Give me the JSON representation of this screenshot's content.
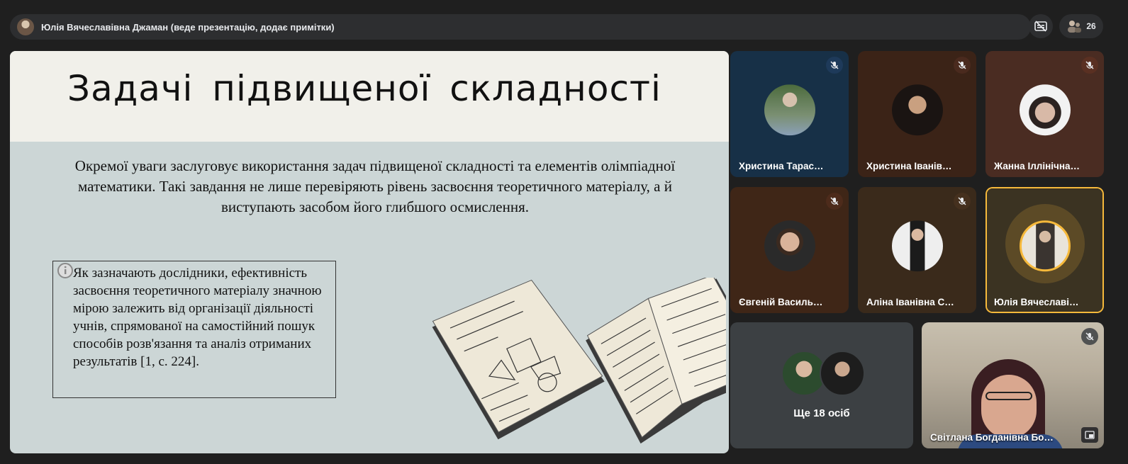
{
  "header": {
    "presenter": "Юлія Вячеславівна Джаман (веде презентацію, додає примітки)",
    "participants_count": "26"
  },
  "slide": {
    "title": "Задачі  підвищеної  складності",
    "paragraph": "Окремої уваги заслуговує використання задач підвищеної складності та елементів олімпіадної математики. Такі завдання не лише перевіряють рівень засвоєння теоретичного матеріалу, а й виступають засобом його глибшого осмислення.",
    "quote": "Як зазначають дослідники, ефективність засвоєння теоретичного матеріалу значною мірою залежить від організації діяльності учнів, спрямованої на самостійний пошук способів розв'язання та аналіз отриманих результатів [1, с. 224]."
  },
  "participants": [
    {
      "name": "Христина Тарас…",
      "bg": "#173047",
      "mute_bg": "#1e3a5a"
    },
    {
      "name": "Христина Іванів…",
      "bg": "#3b2317",
      "mute_bg": "#4a2a1e"
    },
    {
      "name": "Жанна Іллінічна…",
      "bg": "#4a2c22",
      "mute_bg": "#5a3022"
    },
    {
      "name": "Євгеній Василь…",
      "bg": "#3f2617",
      "mute_bg": "#4d2b1b"
    },
    {
      "name": "Аліна Іванівна С…",
      "bg": "#3a2a1b",
      "mute_bg": "#45301e"
    },
    {
      "name": "Юлія Вячеславі…",
      "bg": "#3b3322",
      "mute_bg": "#3b3322"
    }
  ],
  "more": {
    "label": "Ще 18 осіб"
  },
  "video": {
    "name": "Світлана Богданівна Бо…"
  },
  "colors": {
    "active_speaker_border": "#f6b93b",
    "page_bg": "#1f1f1f",
    "tile_gray": "#3c4043"
  },
  "icons": [
    "presenter-avatar",
    "no-captions-icon",
    "people-icon",
    "info-icon",
    "mic-off-icon",
    "pip-icon"
  ]
}
